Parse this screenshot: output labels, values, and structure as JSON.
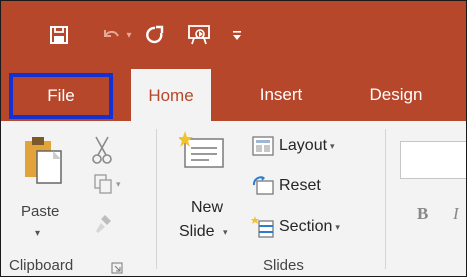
{
  "qat": {
    "icons": [
      "save-icon",
      "undo-icon",
      "dropdown-arrow-icon",
      "redo-icon",
      "start-from-beginning-icon",
      "customize-qat-icon"
    ]
  },
  "tabs": {
    "file": "File",
    "home": "Home",
    "insert": "Insert",
    "design": "Design"
  },
  "clipboard": {
    "paste": "Paste",
    "group": "Clipboard"
  },
  "slides": {
    "new_slide_line1": "New",
    "new_slide_line2": "Slide",
    "layout": "Layout",
    "reset": "Reset",
    "section": "Section",
    "group": "Slides"
  },
  "font": {
    "bold": "B",
    "italic": "I"
  },
  "colors": {
    "accent": "#b7472a",
    "file_highlight": "#1330d3"
  }
}
